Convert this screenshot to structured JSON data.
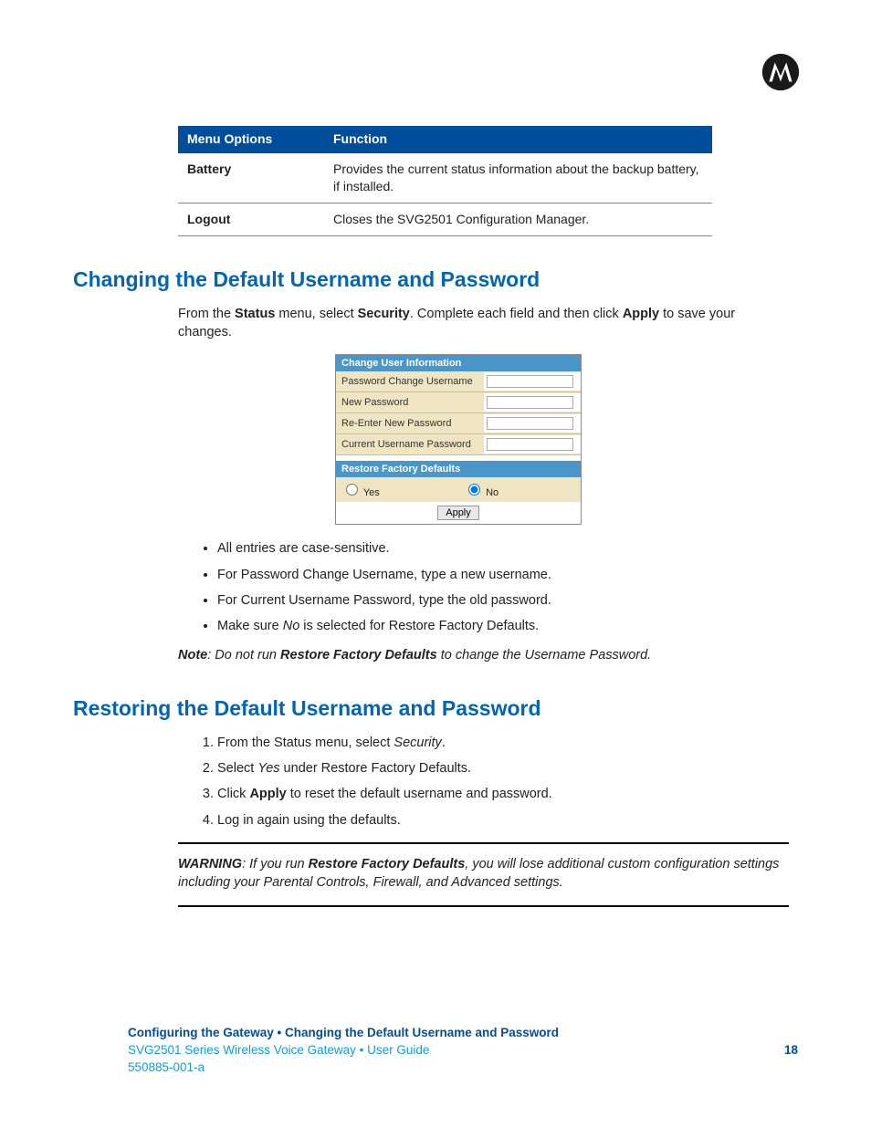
{
  "table": {
    "h1": "Menu Options",
    "h2": "Function",
    "r1k": "Battery",
    "r1v": "Provides the current status information about the backup battery, if installed.",
    "r2k": "Logout",
    "r2v": "Closes the SVG2501 Configuration Manager."
  },
  "h_change": "Changing the Default Username and Password",
  "p1a": "From the ",
  "p1b": "Status",
  "p1c": " menu, select ",
  "p1d": "Security",
  "p1e": ". Complete each field and then click ",
  "p1f": "Apply",
  "p1g": " to save your changes.",
  "form": {
    "head1": "Change User Information",
    "l1": "Password Change Username",
    "l2": "New Password",
    "l3": "Re-Enter New Password",
    "l4": "Current Username Password",
    "head2": "Restore Factory Defaults",
    "yes": "Yes",
    "no": "No",
    "apply": "Apply"
  },
  "bul1": "All entries are case-sensitive.",
  "bul2": "For Password Change Username, type a new username.",
  "bul3": "For Current Username Password, type the old password.",
  "bul4a": "Make sure ",
  "bul4b": "No",
  "bul4c": " is selected for Restore Factory Defaults.",
  "note_lbl": "Note",
  "note_a": ": Do not run ",
  "note_b": "Restore Factory Defaults",
  "note_c": " to change the Username Password.",
  "h_restore": "Restoring the Default Username and Password",
  "ol1a": "From the Status menu, select ",
  "ol1b": "Security",
  "ol1c": ".",
  "ol2a": "Select ",
  "ol2b": "Yes",
  "ol2c": " under Restore Factory Defaults.",
  "ol3a": "Click ",
  "ol3b": "Apply",
  "ol3c": " to reset the default username and password.",
  "ol4": "Log in again using the defaults.",
  "warn_lbl": "WARNING",
  "warn_a": ": If you run ",
  "warn_b": "Restore Factory Defaults",
  "warn_c": ", you will lose additional custom configuration settings including your Parental Controls, Firewall, and Advanced settings.",
  "footer": {
    "bc": "Configuring the Gateway • Changing the Default Username and Password",
    "guide": "SVG2501 Series Wireless Voice Gateway • User Guide",
    "page": "18",
    "doc": "550885-001-a"
  }
}
